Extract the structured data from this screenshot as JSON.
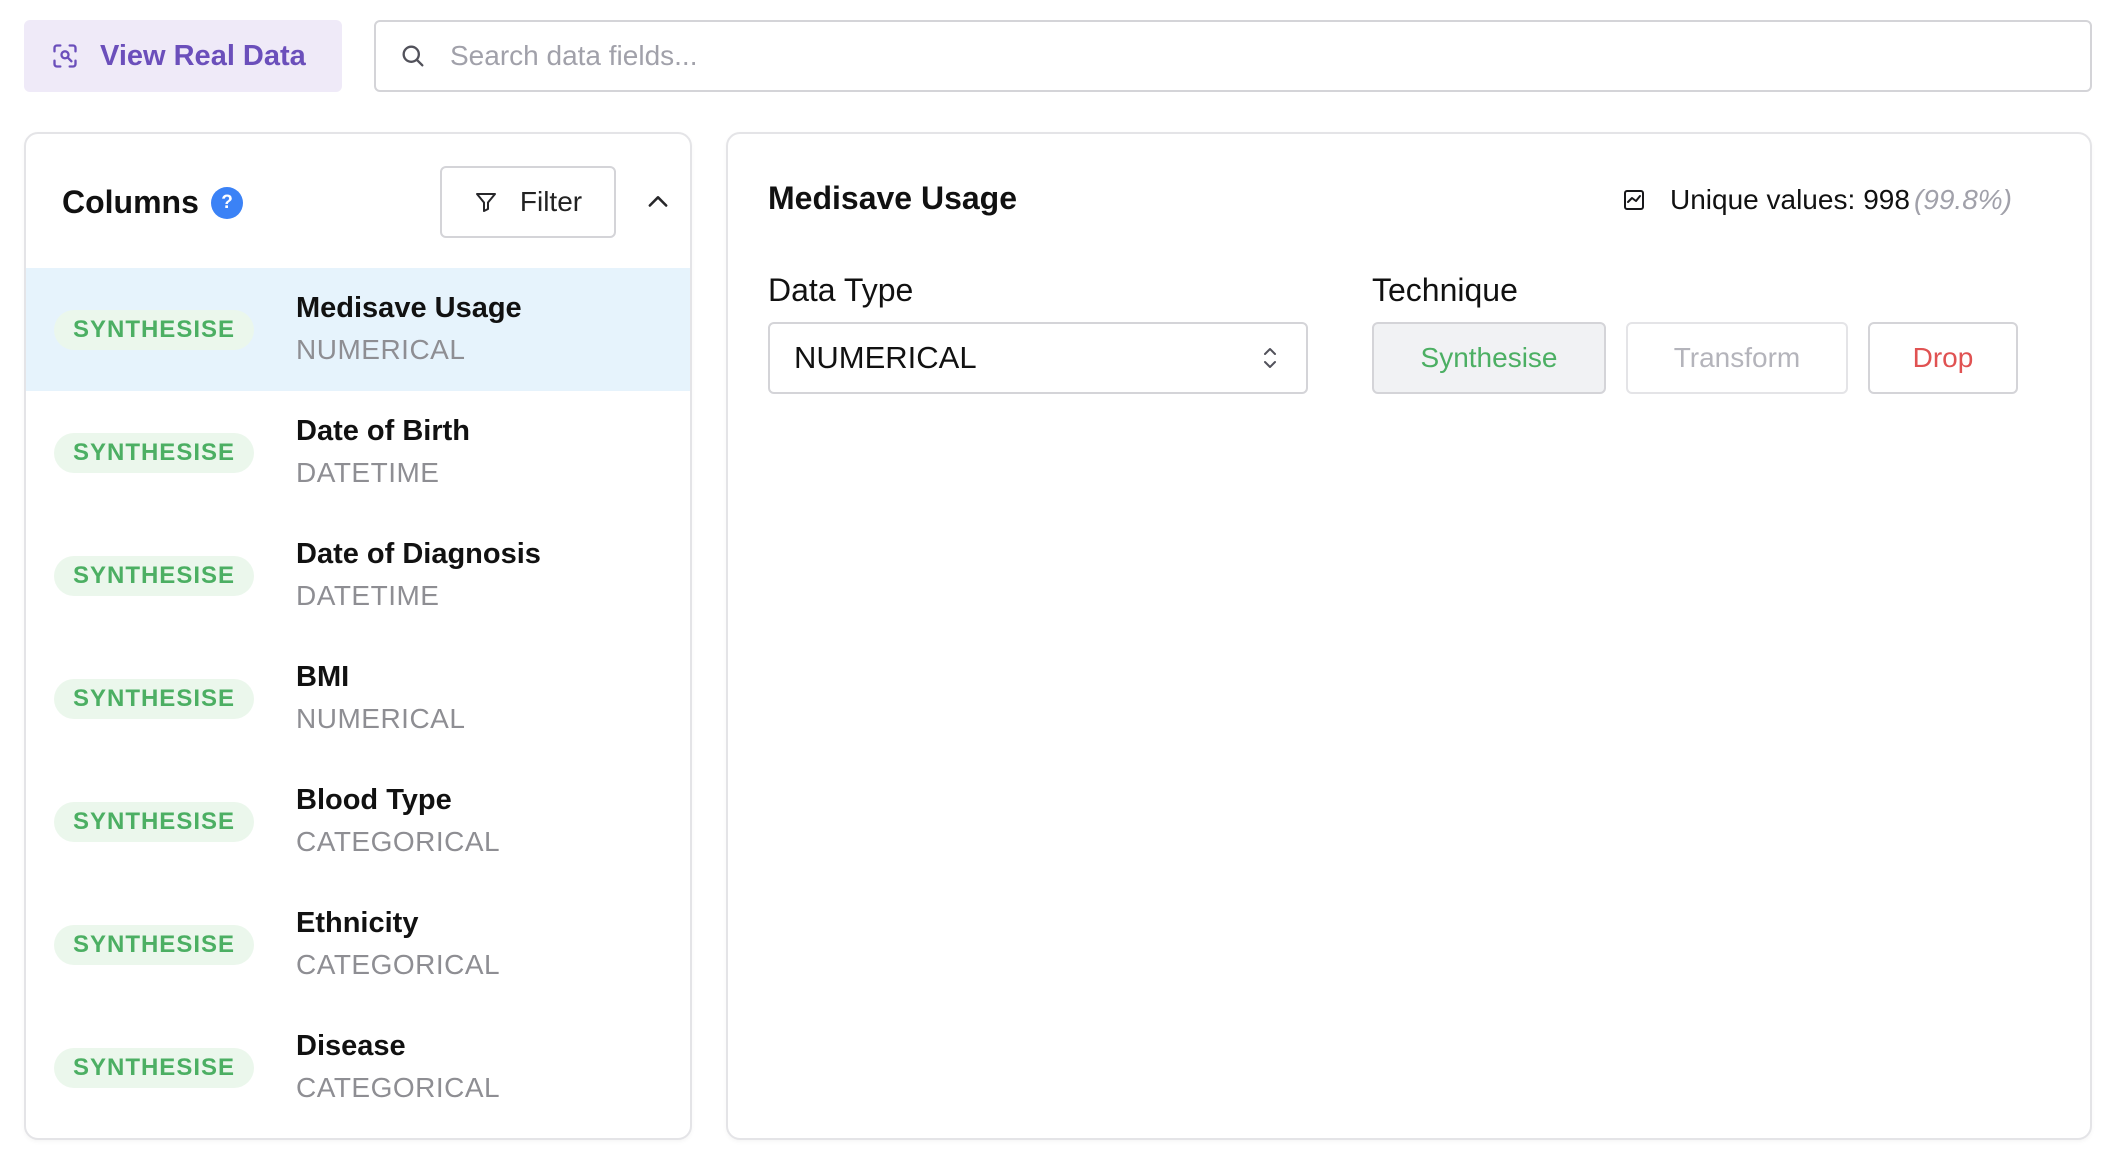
{
  "toolbar": {
    "view_real_data_label": "View Real Data",
    "search_placeholder": "Search data fields..."
  },
  "columns_panel": {
    "title": "Columns",
    "help_symbol": "?",
    "filter_label": "Filter",
    "items": [
      {
        "badge": "SYNTHESISE",
        "name": "Medisave Usage",
        "type": "NUMERICAL",
        "selected": true
      },
      {
        "badge": "SYNTHESISE",
        "name": "Date of Birth",
        "type": "DATETIME"
      },
      {
        "badge": "SYNTHESISE",
        "name": "Date of Diagnosis",
        "type": "DATETIME"
      },
      {
        "badge": "SYNTHESISE",
        "name": "BMI",
        "type": "NUMERICAL"
      },
      {
        "badge": "SYNTHESISE",
        "name": "Blood Type",
        "type": "CATEGORICAL"
      },
      {
        "badge": "SYNTHESISE",
        "name": "Ethnicity",
        "type": "CATEGORICAL"
      },
      {
        "badge": "SYNTHESISE",
        "name": "Disease",
        "type": "CATEGORICAL"
      }
    ]
  },
  "detail": {
    "title": "Medisave Usage",
    "unique_label": "Unique values:",
    "unique_count": "998",
    "unique_pct": "(99.8%)",
    "data_type_label": "Data Type",
    "data_type_value": "NUMERICAL",
    "technique_label": "Technique",
    "techniques": [
      "Synthesise",
      "Transform",
      "Drop"
    ]
  },
  "colors": {
    "accent_purple": "#6b4fbb",
    "synth_green": "#4caf63",
    "drop_red": "#e05252",
    "selected_row": "#e6f3fc",
    "help_blue": "#3b82f6"
  },
  "icons": {
    "view_real_data": "scan-face-icon",
    "search": "search-icon",
    "help": "help-circle-icon",
    "filter": "filter-funnel-icon",
    "collapse": "chevron-up-icon",
    "unique": "chart-square-icon",
    "select": "chevron-up-down-icon"
  }
}
